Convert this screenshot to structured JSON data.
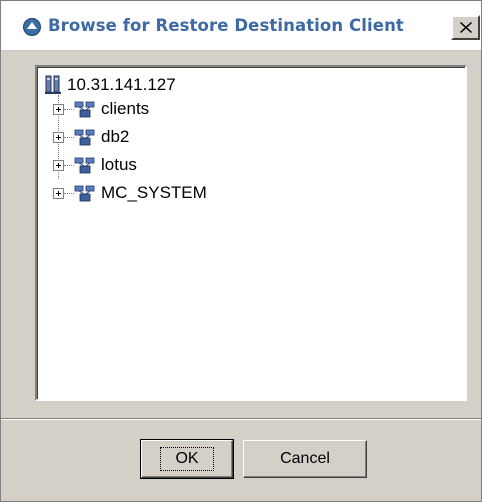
{
  "dialog": {
    "title": "Browse for Restore Destination Client",
    "close_label": "Close"
  },
  "tree": {
    "root": {
      "label": "10.31.141.127",
      "icon": "server-icon"
    },
    "children": [
      {
        "label": "clients",
        "icon": "client-group-icon",
        "collapsed": true
      },
      {
        "label": "db2",
        "icon": "client-group-icon",
        "collapsed": true
      },
      {
        "label": "lotus",
        "icon": "client-group-icon",
        "collapsed": true
      },
      {
        "label": "MC_SYSTEM",
        "icon": "client-group-icon",
        "collapsed": true
      }
    ]
  },
  "buttons": {
    "ok_label": "OK",
    "cancel_label": "Cancel"
  },
  "colors": {
    "title_text": "#3e6aa3",
    "dialog_bg": "#d4d0c8",
    "tree_bg": "#ffffff"
  }
}
